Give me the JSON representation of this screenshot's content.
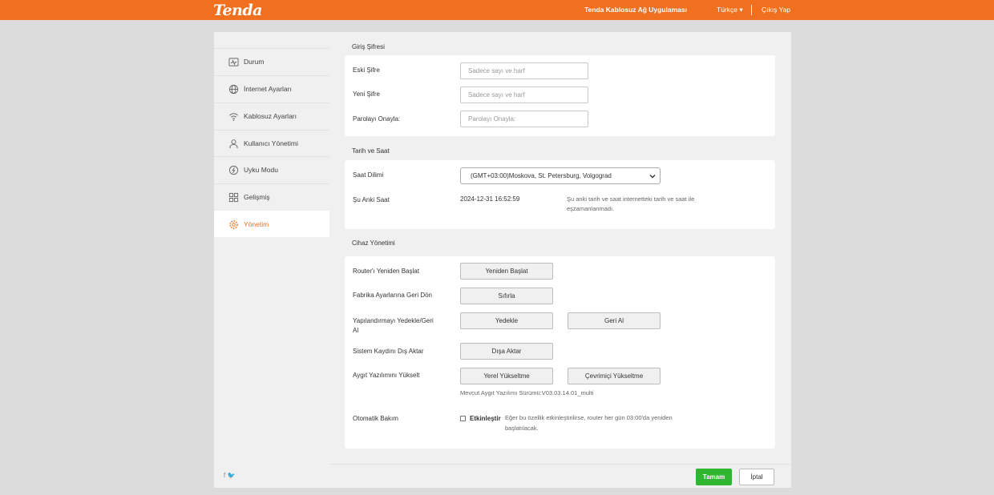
{
  "header": {
    "logo": "Tenda",
    "app_title": "Tenda Kablosuz Ağ Uygulaması",
    "language": "Türkçe ▾",
    "logout": "Çıkış Yap"
  },
  "sidebar": {
    "items": [
      {
        "label": "Durum",
        "icon": "status-icon"
      },
      {
        "label": "İnternet Ayarları",
        "icon": "globe-icon"
      },
      {
        "label": "Kablosuz Ayarları",
        "icon": "wifi-icon"
      },
      {
        "label": "Kullanıcı Yönetimi",
        "icon": "user-icon"
      },
      {
        "label": "Uyku Modu",
        "icon": "sleep-icon"
      },
      {
        "label": "Gelişmiş",
        "icon": "grid-icon"
      },
      {
        "label": "Yönetim",
        "icon": "gear-icon",
        "active": true
      }
    ],
    "social": "f  🐦"
  },
  "login_password": {
    "title": "Giriş Şifresi",
    "old_label": "Eski Şifre",
    "old_placeholder": "Sadece sayı ve harf",
    "new_label": "Yeni Şifre",
    "new_placeholder": "Sadece sayı ve harf",
    "confirm_label": "Parolayı Onayla:",
    "confirm_placeholder": "Parolayı Onayla:"
  },
  "datetime": {
    "title": "Tarih ve Saat",
    "tz_label": "Saat Dilimi",
    "tz_value": "(GMT+03:00)Moskova, St. Petersburg, Volgograd",
    "current_label": "Şu Anki Saat",
    "current_value": "2024-12-31 16:52:59",
    "sync_note_1": "Şu anki tarih ve saat internetteki tarih ve saat ile",
    "sync_note_2": "eşzamanlanmadı."
  },
  "device": {
    "title": "Cihaz Yönetimi",
    "reboot_label": "Router'ı Yeniden Başlat",
    "reboot_btn": "Yeniden Başlat",
    "factory_label": "Fabrika Ayarlarına Geri Dön",
    "factory_btn": "Sıfırla",
    "backup_label_1": "Yapılandırmayı Yedekle/Geri",
    "backup_label_2": "Al",
    "backup_btn": "Yedekle",
    "restore_btn": "Geri Al",
    "syslog_label": "Sistem Kaydını Dış Aktar",
    "syslog_btn": "Dışa Aktar",
    "firmware_label": "Aygıt Yazılımını Yükselt",
    "local_upgrade_btn": "Yerel Yükseltme",
    "online_upgrade_btn": "Çevrimiçi Yükseltme",
    "firmware_version": "Mevcut Aygıt Yazılımı Sürümü:V03.03.14.01_multi",
    "auto_label": "Otomatik Bakım",
    "auto_checkbox": "Etkinleştir",
    "auto_note_1": "Eğer bu özellik etkinleştirilirse, router her gün 03:00'da yeniden",
    "auto_note_2": "başlatılacak."
  },
  "footer": {
    "ok": "Tamam",
    "cancel": "İptal"
  },
  "colors": {
    "brand": "#f07020",
    "ok": "#2fb52f"
  }
}
